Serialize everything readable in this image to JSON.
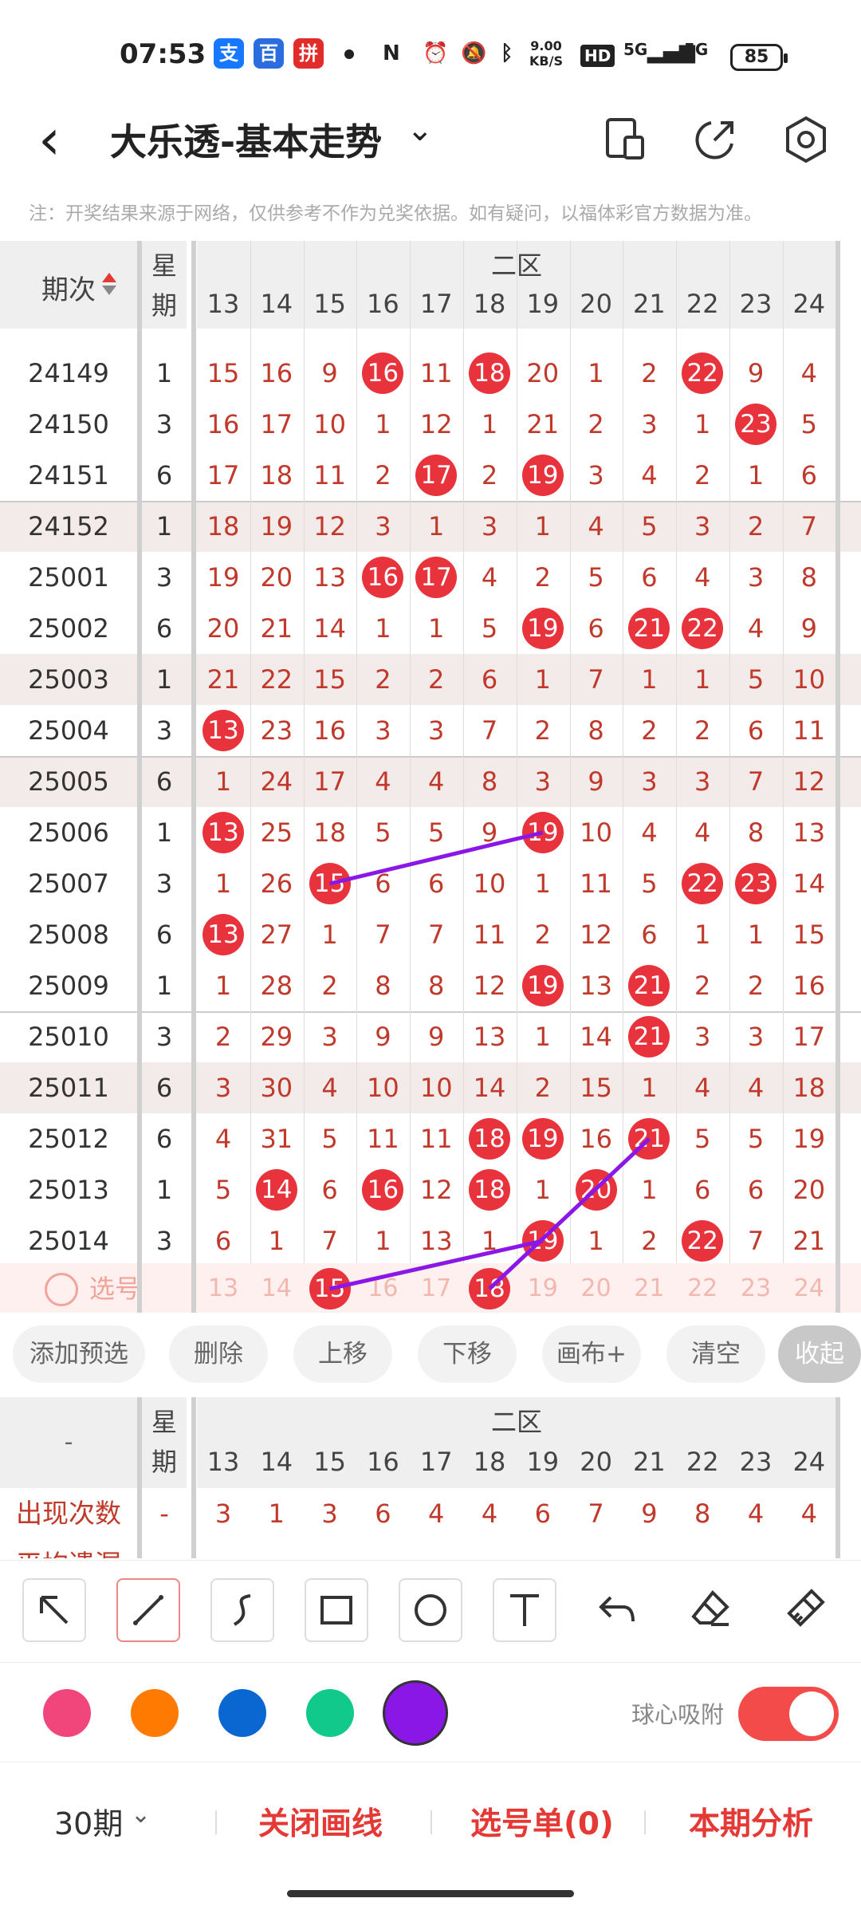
{
  "status_bar": {
    "time": "07:53",
    "apps": [
      {
        "name": "alipay-icon",
        "glyph": "支",
        "color": "#1677ff"
      },
      {
        "name": "baidu-icon",
        "glyph": "百",
        "color": "#2b6de0"
      },
      {
        "name": "pinduoduo-icon",
        "glyph": "拼",
        "color": "#e22c2c"
      }
    ],
    "speed_top": "9.00",
    "speed_unit": "KB/S",
    "hd_label": "HD",
    "net1": "5G",
    "net2": "5G",
    "battery": "85"
  },
  "header": {
    "title": "大乐透-基本走势",
    "icons": [
      "device-icon",
      "share-icon",
      "settings-icon"
    ]
  },
  "notice": "注：开奖结果来源于网络，仅供参考不作为兑奖依据。如有疑问，以福体彩官方数据为准。",
  "table": {
    "issue_header": "期次",
    "week_header_1": "星",
    "week_header_2": "期",
    "zone_label": "二区",
    "columns": [
      "13",
      "14",
      "15",
      "16",
      "17",
      "18",
      "19",
      "20",
      "21",
      "22",
      "23",
      "24"
    ],
    "rows": [
      {
        "issue": "24149",
        "week": "1",
        "cells": [
          "15",
          "16",
          "9",
          "16",
          "11",
          "18",
          "20",
          "1",
          "2",
          "22",
          "9",
          "4"
        ],
        "balls": [
          3,
          5,
          9
        ]
      },
      {
        "issue": "24150",
        "week": "3",
        "cells": [
          "16",
          "17",
          "10",
          "1",
          "12",
          "1",
          "21",
          "2",
          "3",
          "1",
          "23",
          "5"
        ],
        "balls": [
          10
        ]
      },
      {
        "issue": "24151",
        "week": "6",
        "cells": [
          "17",
          "18",
          "11",
          "2",
          "17",
          "2",
          "19",
          "3",
          "4",
          "2",
          "1",
          "6"
        ],
        "balls": [
          4,
          6
        ]
      },
      {
        "issue": "24152",
        "week": "1",
        "cells": [
          "18",
          "19",
          "12",
          "3",
          "1",
          "3",
          "1",
          "4",
          "5",
          "3",
          "2",
          "7"
        ],
        "balls": []
      },
      {
        "issue": "25001",
        "week": "3",
        "cells": [
          "19",
          "20",
          "13",
          "16",
          "17",
          "4",
          "2",
          "5",
          "6",
          "4",
          "3",
          "8"
        ],
        "balls": [
          3,
          4
        ]
      },
      {
        "issue": "25002",
        "week": "6",
        "cells": [
          "20",
          "21",
          "14",
          "1",
          "1",
          "5",
          "19",
          "6",
          "21",
          "22",
          "4",
          "9"
        ],
        "balls": [
          6,
          8,
          9
        ]
      },
      {
        "issue": "25003",
        "week": "1",
        "cells": [
          "21",
          "22",
          "15",
          "2",
          "2",
          "6",
          "1",
          "7",
          "1",
          "1",
          "5",
          "10"
        ],
        "balls": []
      },
      {
        "issue": "25004",
        "week": "3",
        "cells": [
          "13",
          "23",
          "16",
          "3",
          "3",
          "7",
          "2",
          "8",
          "2",
          "2",
          "6",
          "11"
        ],
        "balls": [
          0
        ]
      },
      {
        "issue": "25005",
        "week": "6",
        "cells": [
          "1",
          "24",
          "17",
          "4",
          "4",
          "8",
          "3",
          "9",
          "3",
          "3",
          "7",
          "12"
        ],
        "balls": []
      },
      {
        "issue": "25006",
        "week": "1",
        "cells": [
          "13",
          "25",
          "18",
          "5",
          "5",
          "9",
          "19",
          "10",
          "4",
          "4",
          "8",
          "13"
        ],
        "balls": [
          0,
          6
        ]
      },
      {
        "issue": "25007",
        "week": "3",
        "cells": [
          "1",
          "26",
          "15",
          "6",
          "6",
          "10",
          "1",
          "11",
          "5",
          "22",
          "23",
          "14"
        ],
        "balls": [
          2,
          9,
          10
        ]
      },
      {
        "issue": "25008",
        "week": "6",
        "cells": [
          "13",
          "27",
          "1",
          "7",
          "7",
          "11",
          "2",
          "12",
          "6",
          "1",
          "1",
          "15"
        ],
        "balls": [
          0
        ]
      },
      {
        "issue": "25009",
        "week": "1",
        "cells": [
          "1",
          "28",
          "2",
          "8",
          "8",
          "12",
          "19",
          "13",
          "21",
          "2",
          "2",
          "16"
        ],
        "balls": [
          6,
          8
        ]
      },
      {
        "issue": "25010",
        "week": "3",
        "cells": [
          "2",
          "29",
          "3",
          "9",
          "9",
          "13",
          "1",
          "14",
          "21",
          "3",
          "3",
          "17"
        ],
        "balls": [
          8
        ]
      },
      {
        "issue": "25011",
        "week": "6",
        "cells": [
          "3",
          "30",
          "4",
          "10",
          "10",
          "14",
          "2",
          "15",
          "1",
          "4",
          "4",
          "18"
        ],
        "balls": []
      },
      {
        "issue": "25012",
        "week": "6",
        "cells": [
          "4",
          "31",
          "5",
          "11",
          "11",
          "18",
          "19",
          "16",
          "21",
          "5",
          "5",
          "19"
        ],
        "balls": [
          5,
          6,
          8
        ]
      },
      {
        "issue": "25013",
        "week": "1",
        "cells": [
          "5",
          "14",
          "6",
          "16",
          "12",
          "18",
          "1",
          "20",
          "1",
          "6",
          "6",
          "20"
        ],
        "balls": [
          1,
          3,
          5,
          7
        ]
      },
      {
        "issue": "25014",
        "week": "3",
        "cells": [
          "6",
          "1",
          "7",
          "1",
          "13",
          "1",
          "19",
          "1",
          "2",
          "22",
          "7",
          "21"
        ],
        "balls": [
          6,
          9
        ]
      }
    ],
    "select_label": "选号",
    "select_cells": [
      "13",
      "14",
      "15",
      "16",
      "17",
      "18",
      "19",
      "20",
      "21",
      "22",
      "23",
      "24"
    ],
    "select_balls": [
      2,
      5
    ]
  },
  "actions": [
    "添加预选",
    "删除",
    "上移",
    "下移",
    "画布+",
    "清空",
    "收起"
  ],
  "stats": {
    "corner": "-",
    "week_header_1": "星",
    "week_header_2": "期",
    "zone_label": "二区",
    "columns": [
      "13",
      "14",
      "15",
      "16",
      "17",
      "18",
      "19",
      "20",
      "21",
      "22",
      "23",
      "24"
    ],
    "row_label": "出现次数",
    "row_week": "-",
    "row_values": [
      "3",
      "1",
      "3",
      "6",
      "4",
      "4",
      "6",
      "7",
      "9",
      "8",
      "4",
      "4"
    ],
    "row2_label": "平均遗漏"
  },
  "tools": [
    "arrow-tool-icon",
    "line-tool-icon",
    "curve-tool-icon",
    "rectangle-tool-icon",
    "circle-tool-icon",
    "text-tool-icon",
    "undo-icon",
    "eraser-icon",
    "clear-brush-icon"
  ],
  "colors": [
    "#f0467c",
    "#ff7a00",
    "#0a66d0",
    "#10c98a",
    "#8b17e6"
  ],
  "selected_color": "#8b17e6",
  "snap_label": "球心吸附",
  "bottom": {
    "period": "30期",
    "close_draw": "关闭画线",
    "selection": "选号单(0)",
    "analysis": "本期分析"
  }
}
